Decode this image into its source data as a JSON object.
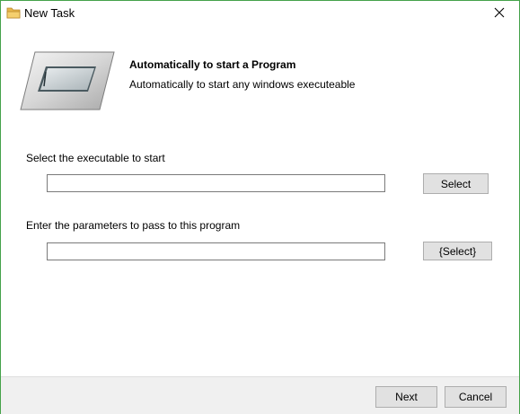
{
  "window": {
    "title": "New Task",
    "icon": "folder-icon",
    "close_icon": "close-icon",
    "border_color": "#45a24a"
  },
  "header": {
    "title": "Automatically to start a Program",
    "subtitle": "Automatically to start any windows executeable",
    "graphic": "program-window-icon"
  },
  "form": {
    "executable_label": "Select the executable to start",
    "executable_value": "",
    "executable_select_label": "Select",
    "params_label": "Enter the parameters to pass to this program",
    "params_value": "",
    "params_select_label": "{Select}"
  },
  "footer": {
    "next_label": "Next",
    "cancel_label": "Cancel"
  }
}
